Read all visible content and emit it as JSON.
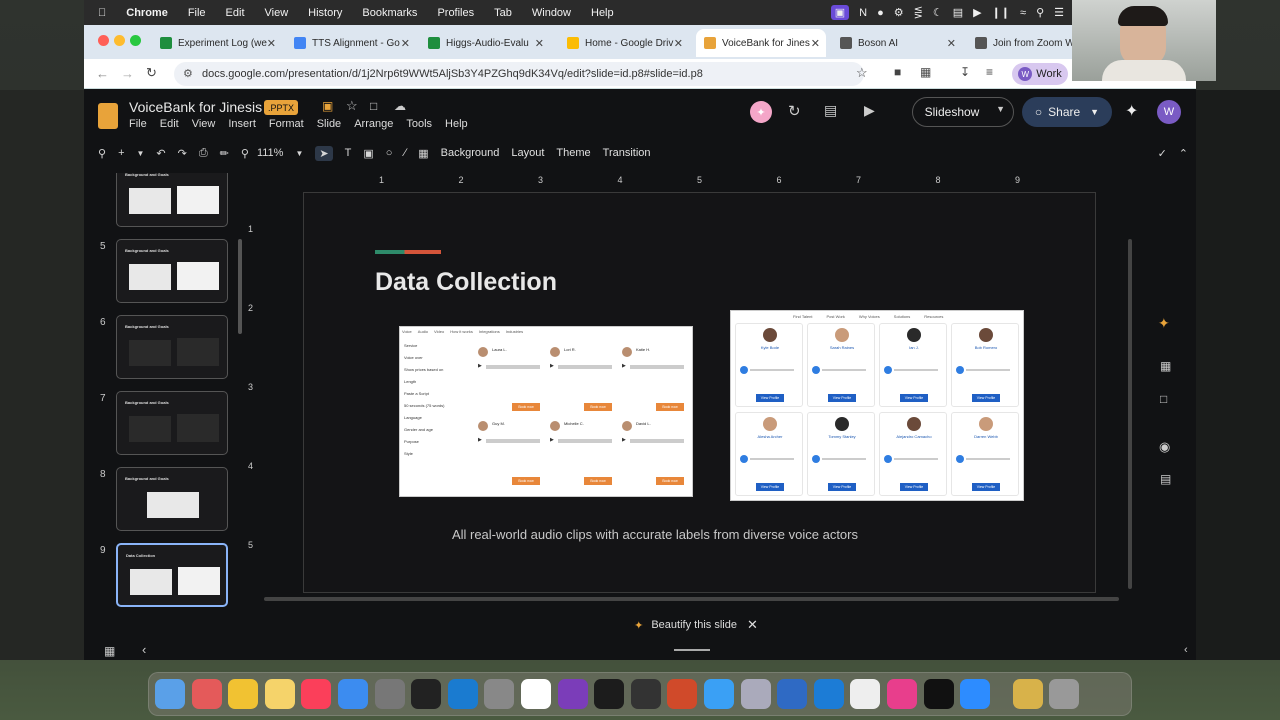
{
  "menubar": {
    "items": [
      "Chrome",
      "File",
      "Edit",
      "View",
      "History",
      "Bookmarks",
      "Profiles",
      "Tab",
      "Window",
      "Help"
    ]
  },
  "tabs": [
    {
      "label": "Experiment Log (we",
      "color": "#1e8e3e",
      "active": false
    },
    {
      "label": "TTS Alignment - Go",
      "color": "#4285f4",
      "active": false
    },
    {
      "label": "Higgs-Audio-Evalu",
      "color": "#1e8e3e",
      "active": false
    },
    {
      "label": "Home - Google Driv",
      "color": "#fbbc04",
      "active": false
    },
    {
      "label": "VoiceBank for Jines",
      "color": "#e8a33a",
      "active": true
    },
    {
      "label": "Boson AI",
      "color": "#555555",
      "active": false
    },
    {
      "label": "Join from Zoom W",
      "color": "#555555",
      "active": false
    }
  ],
  "address": {
    "url": "docs.google.com/presentation/d/1j2Nrp6t9WWt5AljSb3Y4PZGhq9dK34Vq/edit?slide=id.p8#slide=id.p8",
    "profile_label": "Work"
  },
  "app": {
    "doc_title": "VoiceBank for Jinesis",
    "format_badge": ".PPTX",
    "menus": [
      "File",
      "Edit",
      "View",
      "Insert",
      "Format",
      "Slide",
      "Arrange",
      "Tools",
      "Help"
    ],
    "slideshow_label": "Slideshow",
    "share_label": "Share",
    "avatar_initial": "W"
  },
  "toolbar": {
    "zoom": "111%",
    "background_label": "Background",
    "layout_label": "Layout",
    "theme_label": "Theme",
    "transition_label": "Transition"
  },
  "filmstrip": {
    "slides": [
      {
        "number": "",
        "title": "Background and Goals"
      },
      {
        "number": "5",
        "title": "Background and Goals"
      },
      {
        "number": "6",
        "title": "Background and Goals"
      },
      {
        "number": "7",
        "title": "Background and Goals"
      },
      {
        "number": "8",
        "title": "Background and Goals"
      },
      {
        "number": "9",
        "title": "Data Collection"
      }
    ]
  },
  "slide": {
    "title": "Data Collection",
    "caption": "All real-world audio clips with accurate labels from diverse voice actors",
    "shot1_nav": [
      "Voice",
      "Audio",
      "Video",
      "How it works",
      "Integrations",
      "Industries"
    ],
    "shot1_filters": [
      "Service",
      "Voice over",
      "Show prices based on",
      "Length",
      "Paste a Script",
      "50 seconds (75 words)",
      "Language",
      "Gender and age",
      "Purpose",
      "Style"
    ],
    "shot1_actors": [
      "Laura L.",
      "Lori R.",
      "Katie H.",
      "Guy M.",
      "Michelle C.",
      "David L."
    ],
    "shot2_nav": [
      "Find Talent",
      "Post Work",
      "Why Voices",
      "Solutions",
      "Resources"
    ],
    "shot2_actors": [
      "Kyle Bode",
      "Sarah Raines",
      "Ian J.",
      "Bob Romero",
      "Alesha Archer",
      "Tommy Stanley",
      "Alejandro Camacho",
      "Darren Webb"
    ],
    "view_profile_label": "View Profile",
    "book_now_label": "Book now"
  },
  "ruler": {
    "top": [
      "1",
      "2",
      "3",
      "4",
      "5",
      "6",
      "7",
      "8",
      "9"
    ],
    "left": [
      "1",
      "2",
      "3",
      "4",
      "5"
    ]
  },
  "beautify": {
    "label": "Beautify this slide"
  }
}
